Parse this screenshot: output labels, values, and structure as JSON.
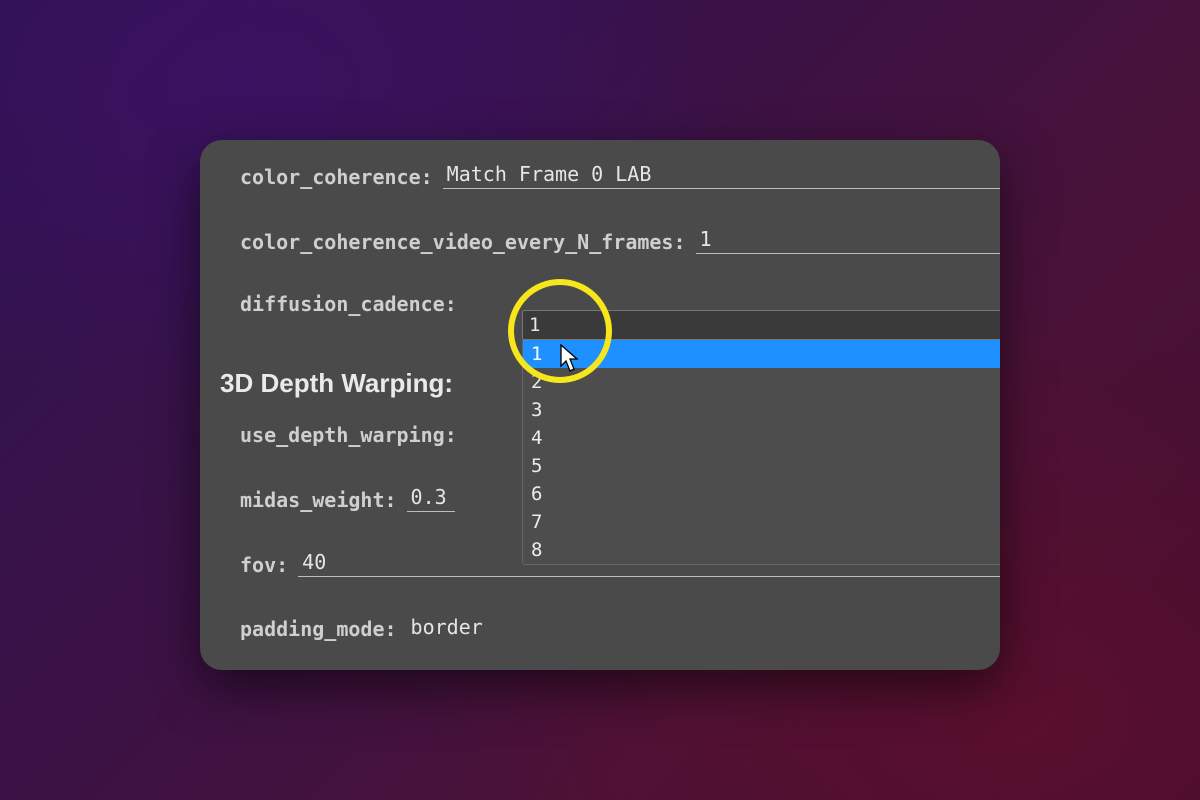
{
  "fields": {
    "color_coherence": {
      "label": "color_coherence:",
      "value": "Match Frame 0 LAB"
    },
    "color_coherence_video_every_N_frames": {
      "label": "color_coherence_video_every_N_frames:",
      "value": "1"
    },
    "diffusion_cadence": {
      "label": "diffusion_cadence:",
      "value": "1",
      "selected": "1"
    },
    "use_depth_warping": {
      "label": "use_depth_warping:",
      "value": ""
    },
    "midas_weight": {
      "label": "midas_weight:",
      "value": "0.3"
    },
    "fov": {
      "label": "fov:",
      "value": "40"
    },
    "padding_mode": {
      "label": "padding_mode:",
      "value": "border"
    }
  },
  "section_header": "3D Depth Warping:",
  "dropdown_options": [
    "1",
    "2",
    "3",
    "4",
    "5",
    "6",
    "7",
    "8"
  ]
}
